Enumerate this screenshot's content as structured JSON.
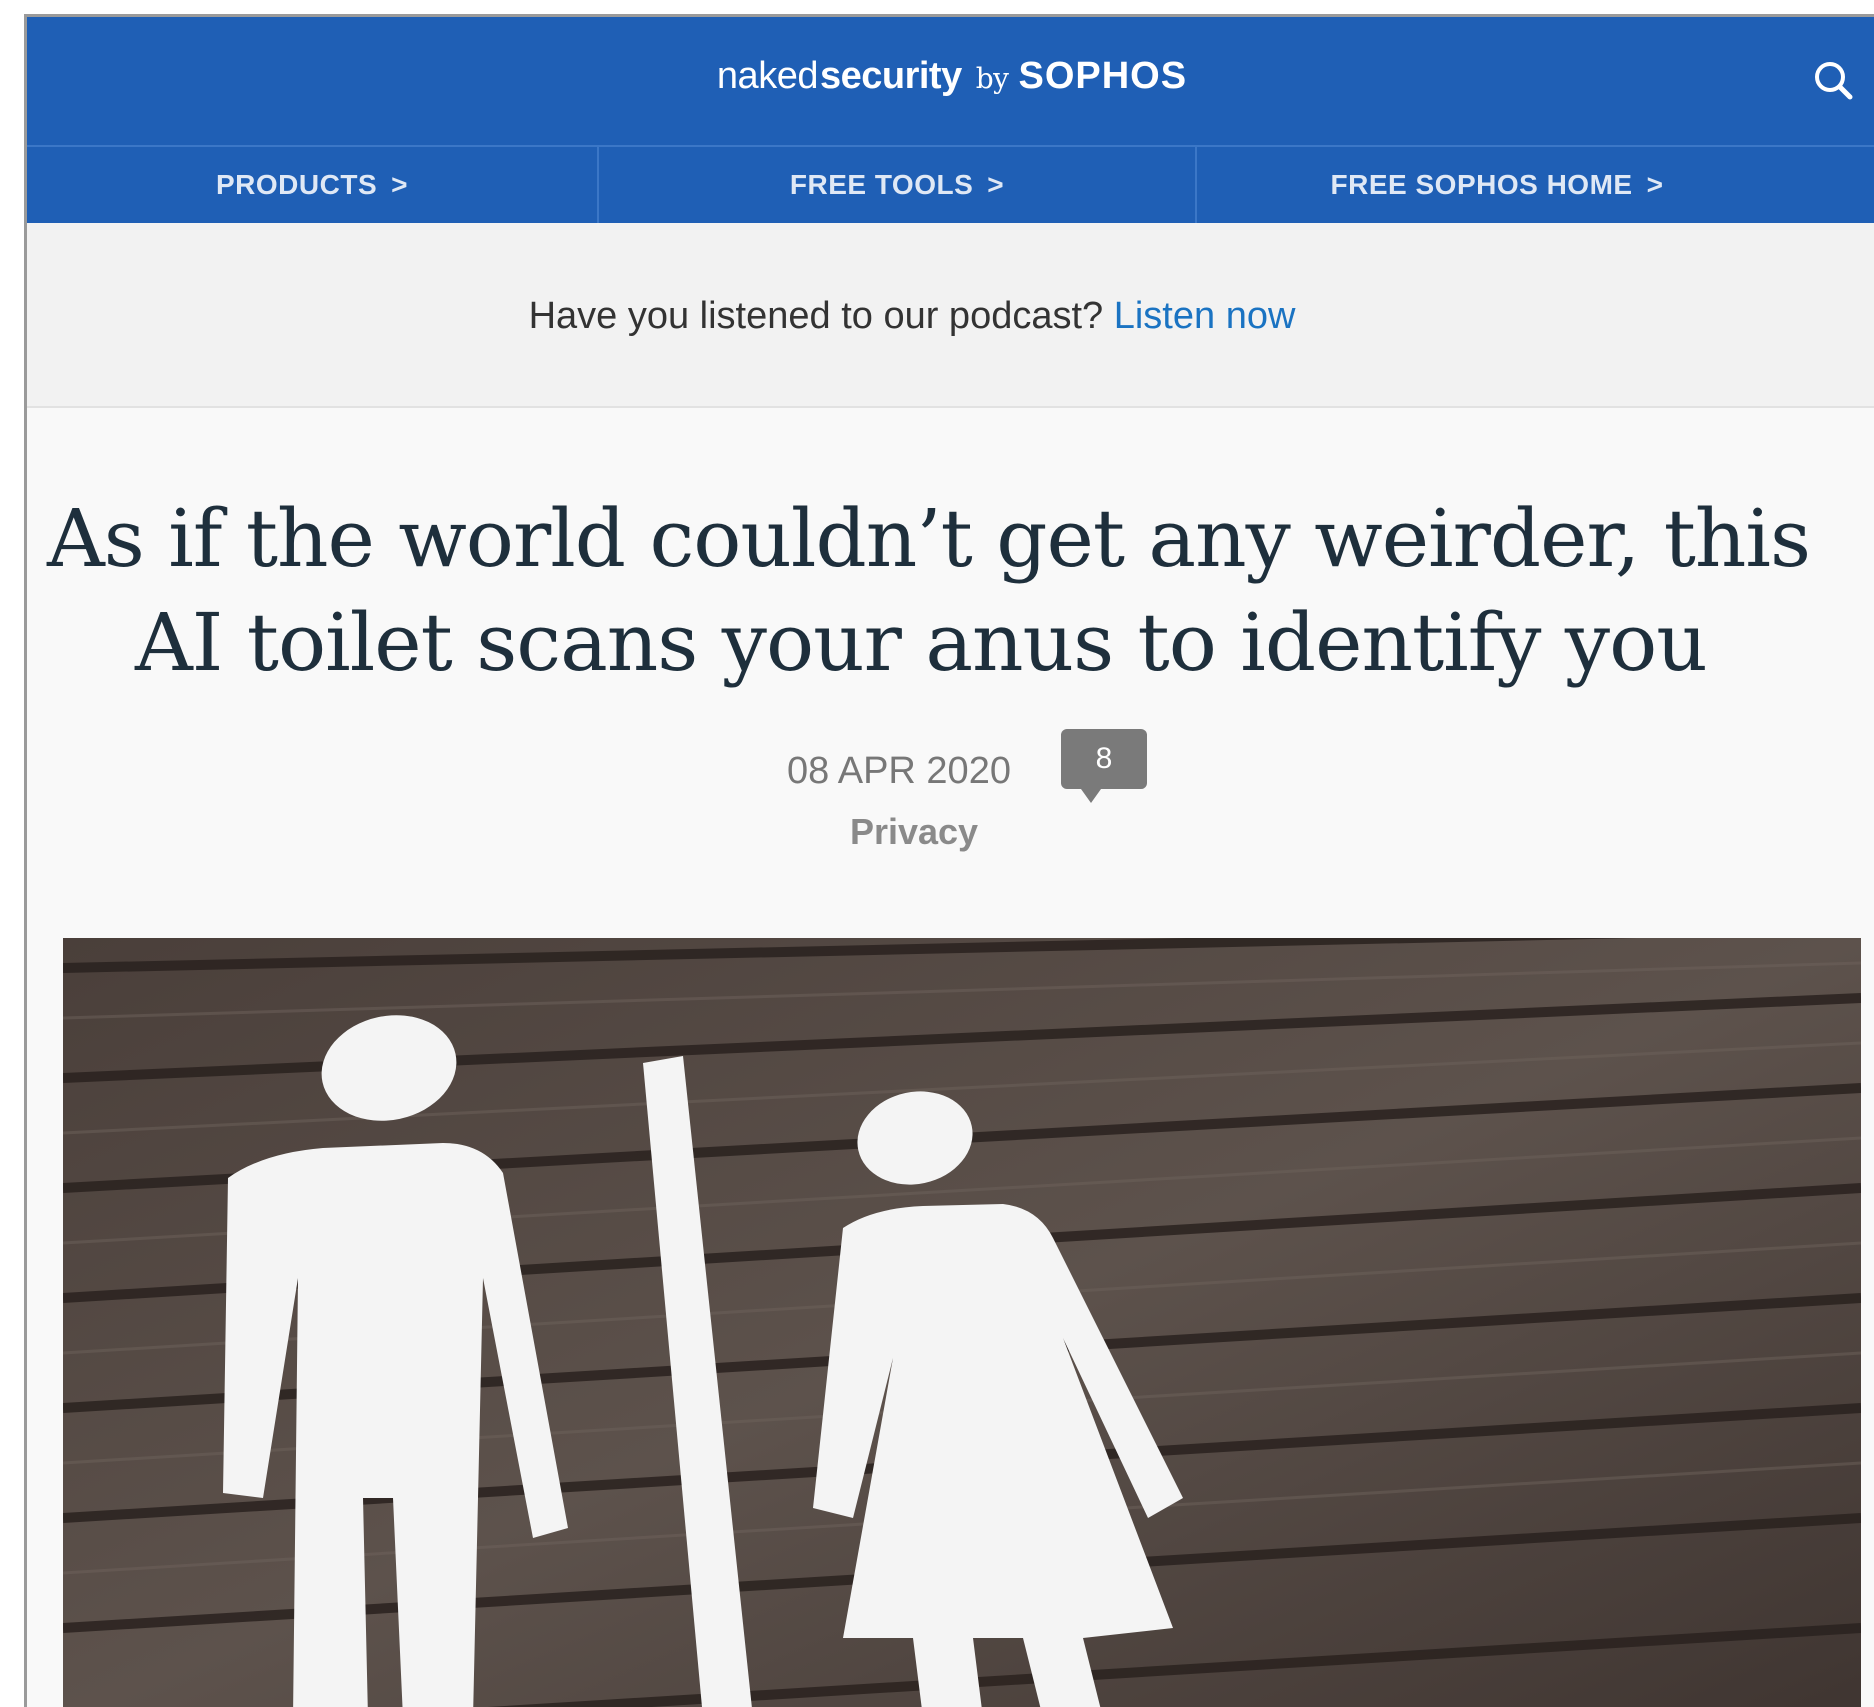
{
  "header": {
    "logo": {
      "naked": "naked",
      "security": "security",
      "by": "by",
      "sophos": "SOPHOS"
    },
    "search_icon": "search-icon"
  },
  "nav": {
    "items": [
      {
        "label": "PRODUCTS",
        "chevron": ">"
      },
      {
        "label": "FREE TOOLS",
        "chevron": ">"
      },
      {
        "label": "FREE SOPHOS HOME",
        "chevron": ">"
      }
    ]
  },
  "banner": {
    "text": "Have you listened to our podcast?",
    "link_text": "Listen now"
  },
  "article": {
    "title_line1": "As if the world couldn’t get any weirder, this",
    "title_line2": "AI toilet scans your anus to identify you",
    "date": "08 APR 2020",
    "comment_count": "8",
    "category": "Privacy"
  },
  "colors": {
    "brand_blue": "#1f5fb5",
    "link_blue": "#1a73c2",
    "title_text": "#1e2f3c"
  }
}
